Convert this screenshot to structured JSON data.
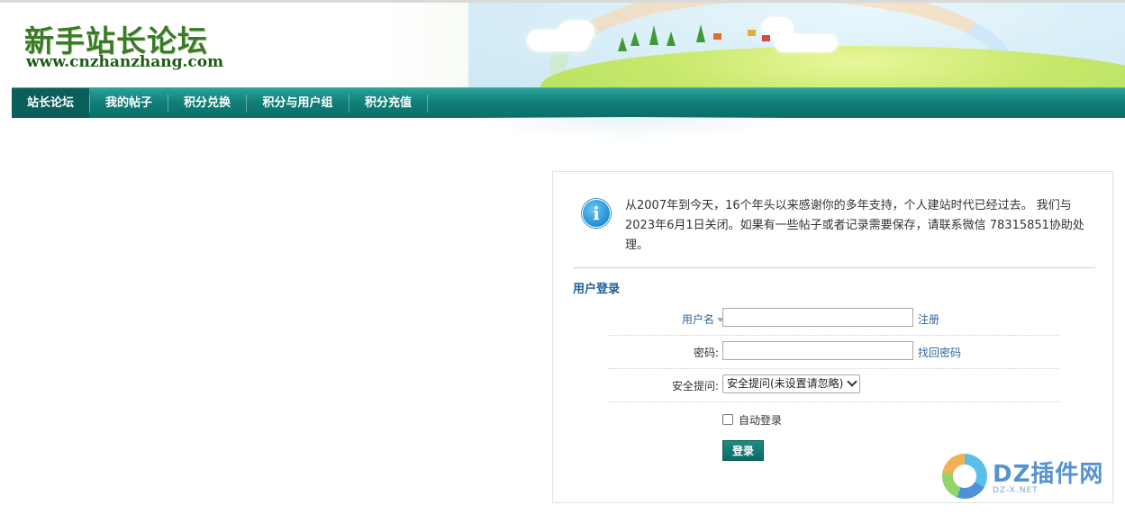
{
  "header": {
    "logo_cn": "新手站长论坛",
    "logo_en": "www.cnzhanzhang.com"
  },
  "nav": {
    "items": [
      {
        "label": "站长论坛",
        "active": true
      },
      {
        "label": "我的帖子",
        "active": false
      },
      {
        "label": "积分兑换",
        "active": false
      },
      {
        "label": "积分与用户组",
        "active": false
      },
      {
        "label": "积分充值",
        "active": false
      }
    ]
  },
  "notice": {
    "icon": "info-icon",
    "text": "从2007年到今天，16个年头以来感谢你的多年支持，个人建站时代已经过去。 我们与2023年6月1日关闭。如果有一些帖子或者记录需要保存，请联系微信 78315851协助处理。"
  },
  "login": {
    "title": "用户登录",
    "username_label": "用户名",
    "username_value": "",
    "register_link": "注册",
    "password_label": "密码:",
    "password_value": "",
    "forgot_link": "找回密码",
    "question_label": "安全提问:",
    "question_selected": "安全提问(未设置请忽略)",
    "auto_login_label": "自动登录",
    "auto_login_checked": false,
    "submit_label": "登录"
  },
  "watermark": {
    "text": "DZ插件网",
    "sub": "DZ-X.NET"
  },
  "colors": {
    "nav_bg": "#128079",
    "link": "#336699",
    "title": "#1a5f9a"
  }
}
